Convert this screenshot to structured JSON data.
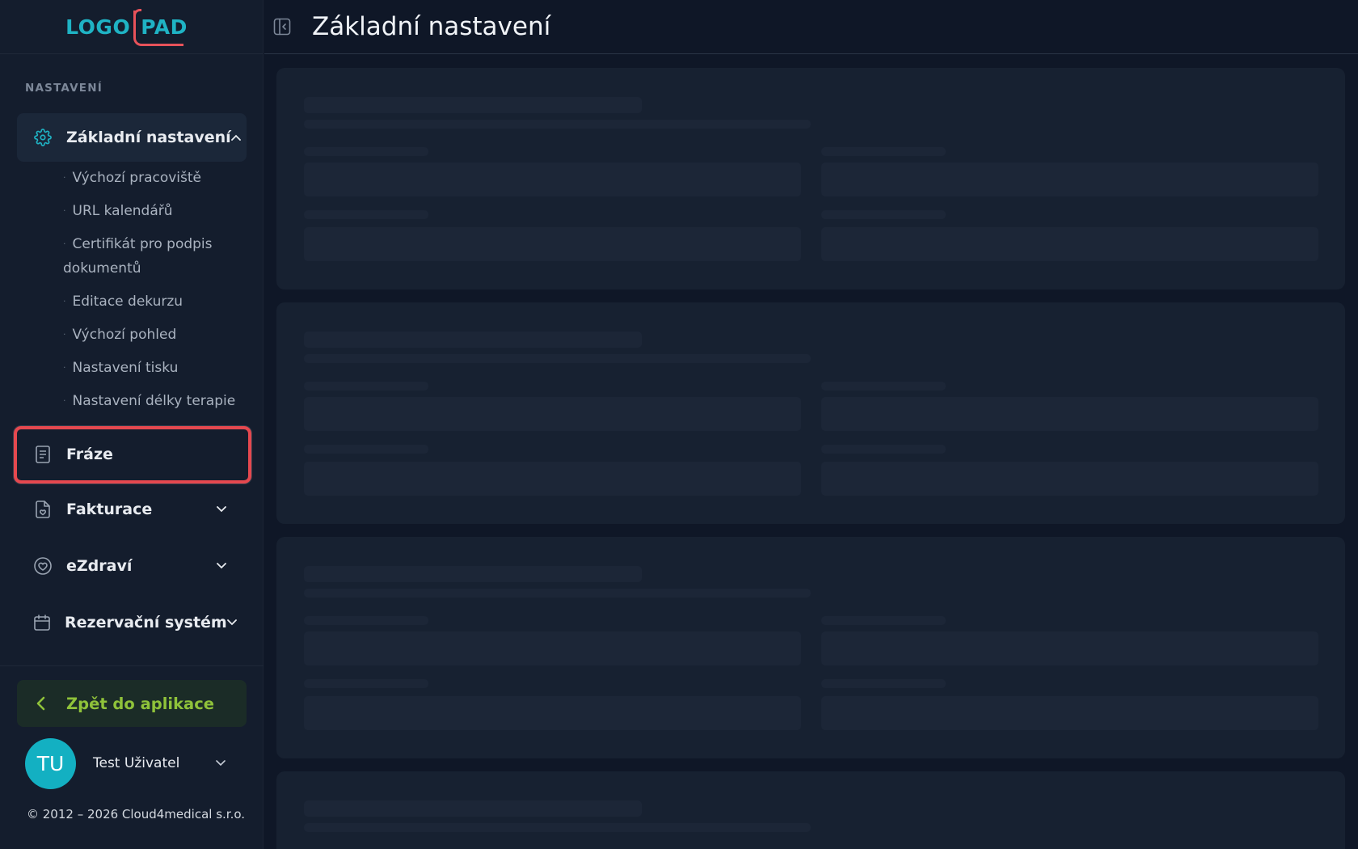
{
  "app": {
    "logo_left": "LOGO",
    "logo_right": "PAD"
  },
  "header": {
    "title": "Základní nastavení"
  },
  "sidebar": {
    "section_label": "NASTAVENÍ",
    "items": [
      {
        "label": "Základní nastavení",
        "icon": "gear-icon",
        "expanded": true
      },
      {
        "label": "Fráze",
        "icon": "document-icon"
      },
      {
        "label": "Fakturace",
        "icon": "invoice-icon"
      },
      {
        "label": "eZdraví",
        "icon": "heart-icon"
      },
      {
        "label": "Rezervační systém",
        "icon": "calendar-icon"
      }
    ],
    "subitems": [
      "Výchozí pracoviště",
      "URL kalendářů",
      "Certifikát pro podpis dokumentů",
      "Editace dekurzu",
      "Výchozí pohled",
      "Nastavení tisku",
      "Nastavení délky terapie"
    ],
    "back_label": "Zpět do aplikace",
    "user": {
      "initials": "TU",
      "name": "Test Uživatel"
    },
    "copyright": "© 2012 – 2026 Cloud4medical s.r.o."
  },
  "colors": {
    "accent": "#1fb3c4",
    "highlight": "#e5484f",
    "back_green": "#8fc23a"
  }
}
